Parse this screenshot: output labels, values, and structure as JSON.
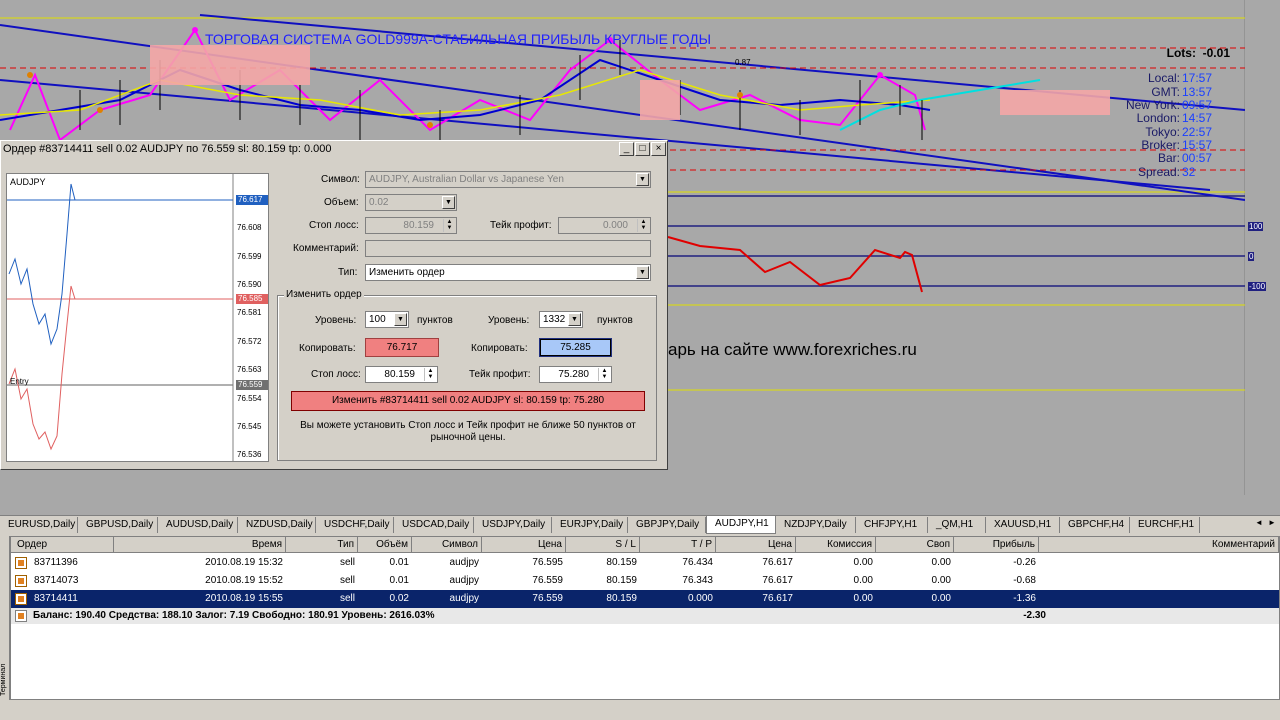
{
  "chart": {
    "title": "ТОРГОВАЯ СИСТЕМА GOLD999A-СТАБИЛЬНАЯ ПРИБЫЛЬ КРУГЛЫЕ ГОДЫ",
    "lots_label": "Lots:",
    "lots_value": "-0.01",
    "info": [
      {
        "k": "Local:",
        "v": "17:57"
      },
      {
        "k": "GMT:",
        "v": "13:57"
      },
      {
        "k": "New York:",
        "v": "09:57"
      },
      {
        "k": "London:",
        "v": "14:57"
      },
      {
        "k": "Tokyo:",
        "v": "22:57"
      },
      {
        "k": "Broker:",
        "v": "15:57"
      },
      {
        "k": "Bar:",
        "v": "00:57"
      },
      {
        "k": "Spread:",
        "v": "32"
      }
    ],
    "site_text": "арь на сайте www.forexriches.ru",
    "point_label": "0.87",
    "indicator_levels": [
      "100",
      "0",
      "-100"
    ],
    "colors": {
      "background": "#a8a8a8",
      "channel": "#1010c0",
      "magenta": "#ff00ff",
      "red": "#e00000"
    }
  },
  "dialog": {
    "title": "Ордер #83714411 sell 0.02 AUDJPY по 76.559 sl: 80.159 tp: 0.000",
    "minimize_icon": "_",
    "maximize_icon": "□",
    "close_icon": "×",
    "mini_chart": {
      "symbol": "AUDJPY",
      "entry_label": "Entry",
      "price_ticks": [
        "76.617",
        "76.608",
        "76.599",
        "76.590",
        "76.585",
        "76.581",
        "76.572",
        "76.563",
        "76.559",
        "76.554",
        "76.545",
        "76.536"
      ],
      "tag_blue": "76.617",
      "tag_red": "76.585",
      "tag_gray": "76.559"
    },
    "symbol_label": "Символ:",
    "symbol_value": "AUDJPY, Australian Dollar vs Japanese Yen",
    "volume_label": "Объем:",
    "volume_value": "0.02",
    "sl_label": "Стоп лосс:",
    "sl_value": "80.159",
    "tp_label": "Тейк профит:",
    "tp_value": "0.000",
    "comment_label": "Комментарий:",
    "comment_value": "",
    "type_label": "Тип:",
    "type_value": "Изменить ордер",
    "group_title": "Изменить ордер",
    "level_label": "Уровень:",
    "level_left": "100",
    "level_right": "1332",
    "points_label": "пунктов",
    "copy_label": "Копировать:",
    "copy_left": "76.717",
    "copy_right": "75.285",
    "sl2_label": "Стоп лосс:",
    "sl2_value": "80.159",
    "tp2_label": "Тейк профит:",
    "tp2_value": "75.280",
    "modify_button": "Изменить #83714411 sell 0.02 AUDJPY sl: 80.159 tp: 75.280",
    "note": "Вы можете установить Стоп лосс и Тейк профит не ближе 50 пунктов от рыночной цены."
  },
  "tabs": [
    "EURUSD,Daily",
    "GBPUSD,Daily",
    "AUDUSD,Daily",
    "NZDUSD,Daily",
    "USDCHF,Daily",
    "USDCAD,Daily",
    "USDJPY,Daily",
    "EURJPY,Daily",
    "GBPJPY,Daily",
    "AUDJPY,H1",
    "NZDJPY,Daily",
    "CHFJPY,H1",
    "_QM,H1",
    "XAUUSD,H1",
    "GBPCHF,H4",
    "EURCHF,H1"
  ],
  "active_tab": "AUDJPY,H1",
  "terminal": {
    "headers": [
      "Ордер",
      "Время",
      "Тип",
      "Объём",
      "Символ",
      "Цена",
      "S / L",
      "T / P",
      "Цена",
      "Комиссия",
      "Своп",
      "Прибыль",
      "Комментарий"
    ],
    "rows": [
      [
        "83711396",
        "2010.08.19 15:32",
        "sell",
        "0.01",
        "audjpy",
        "76.595",
        "80.159",
        "76.434",
        "76.617",
        "0.00",
        "0.00",
        "-0.26",
        ""
      ],
      [
        "83714073",
        "2010.08.19 15:52",
        "sell",
        "0.01",
        "audjpy",
        "76.559",
        "80.159",
        "76.343",
        "76.617",
        "0.00",
        "0.00",
        "-0.68",
        ""
      ],
      [
        "83714411",
        "2010.08.19 15:55",
        "sell",
        "0.02",
        "audjpy",
        "76.559",
        "80.159",
        "0.000",
        "76.617",
        "0.00",
        "0.00",
        "-1.36",
        ""
      ]
    ],
    "summary": "Баланс: 190.40  Средства: 188.10  Залог: 7.19  Свободно: 180.91  Уровень: 2616.03%",
    "summary_profit": "-2.30",
    "side_label": "Терминал"
  }
}
